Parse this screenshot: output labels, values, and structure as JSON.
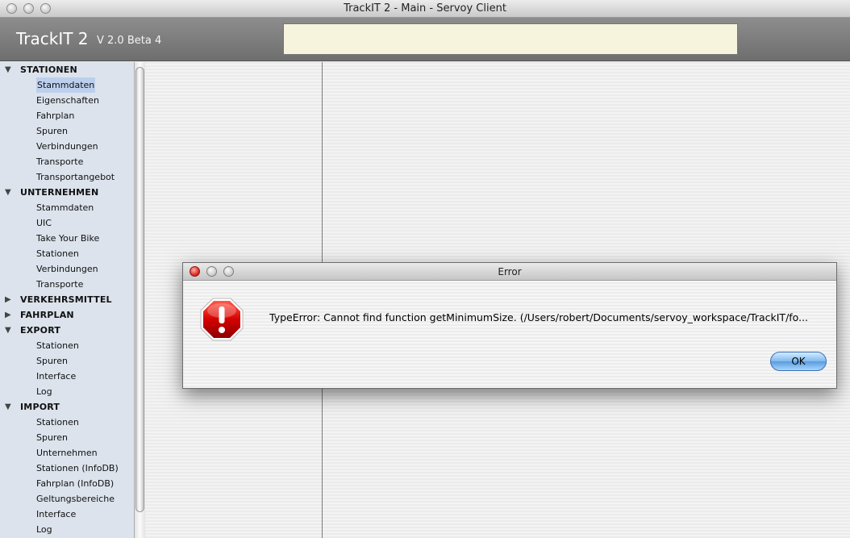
{
  "window": {
    "title": "TrackIT 2 - Main - Servoy Client"
  },
  "header": {
    "brand": "TrackIT 2",
    "version": "V 2.0 Beta 4",
    "search_value": ""
  },
  "sidebar": {
    "rows": [
      {
        "type": "group",
        "label": "STATIONEN",
        "expanded": true
      },
      {
        "type": "child",
        "label": "Stammdaten",
        "selected": true
      },
      {
        "type": "child",
        "label": "Eigenschaften"
      },
      {
        "type": "child",
        "label": "Fahrplan"
      },
      {
        "type": "child",
        "label": "Spuren"
      },
      {
        "type": "child",
        "label": "Verbindungen"
      },
      {
        "type": "child",
        "label": "Transporte"
      },
      {
        "type": "child",
        "label": "Transportangebot"
      },
      {
        "type": "group",
        "label": "UNTERNEHMEN",
        "expanded": true
      },
      {
        "type": "child",
        "label": "Stammdaten"
      },
      {
        "type": "child",
        "label": "UIC"
      },
      {
        "type": "child",
        "label": "Take Your Bike"
      },
      {
        "type": "child",
        "label": "Stationen"
      },
      {
        "type": "child",
        "label": "Verbindungen"
      },
      {
        "type": "child",
        "label": "Transporte"
      },
      {
        "type": "group",
        "label": "VERKEHRSMITTEL",
        "expanded": false
      },
      {
        "type": "group",
        "label": "FAHRPLAN",
        "expanded": false
      },
      {
        "type": "group",
        "label": "EXPORT",
        "expanded": true
      },
      {
        "type": "child",
        "label": "Stationen"
      },
      {
        "type": "child",
        "label": "Spuren"
      },
      {
        "type": "child",
        "label": "Interface"
      },
      {
        "type": "child",
        "label": "Log"
      },
      {
        "type": "group",
        "label": "IMPORT",
        "expanded": true
      },
      {
        "type": "child",
        "label": "Stationen"
      },
      {
        "type": "child",
        "label": "Spuren"
      },
      {
        "type": "child",
        "label": "Unternehmen"
      },
      {
        "type": "child",
        "label": "Stationen (InfoDB)"
      },
      {
        "type": "child",
        "label": "Fahrplan (InfoDB)"
      },
      {
        "type": "child",
        "label": "Geltungsbereiche"
      },
      {
        "type": "child",
        "label": "Interface"
      },
      {
        "type": "child",
        "label": "Log"
      }
    ]
  },
  "dialog": {
    "title": "Error",
    "message": "TypeError: Cannot find function getMinimumSize. (/Users/robert/Documents/servoy_workspace/TrackIT/fo...",
    "ok_label": "OK",
    "icon": "stop-icon"
  },
  "colors": {
    "sidebar_bg": "#dce3ec",
    "header_bg": "#7d7d7d",
    "search_bg": "#f6f4dc",
    "ok_button": "#7fb9ee",
    "stop_red": "#d40000"
  }
}
